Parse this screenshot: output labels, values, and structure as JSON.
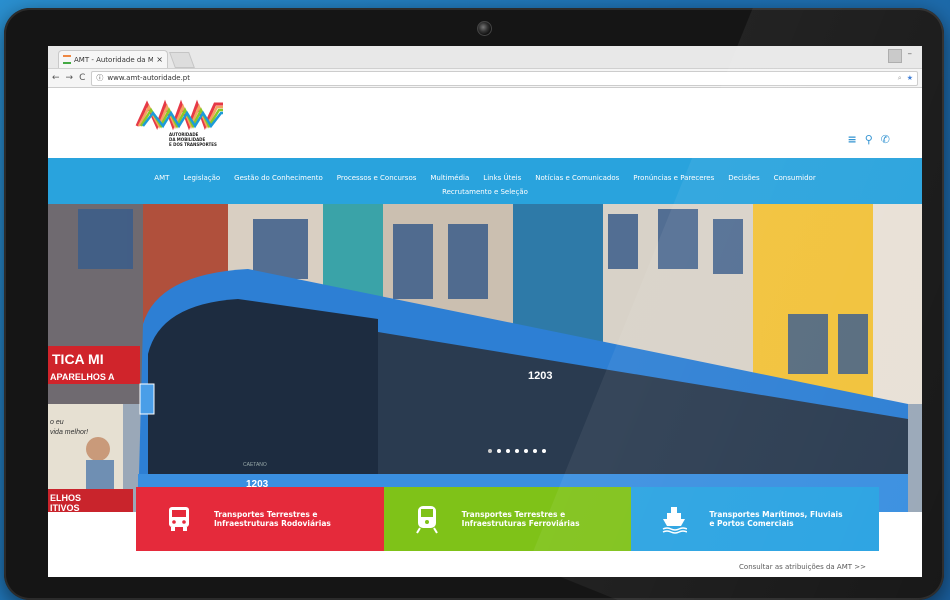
{
  "browser": {
    "tab_title": "AMT - Autoridade da M",
    "tab_close": "×",
    "url": "www.amt-autoridade.pt"
  },
  "logo": {
    "text_line1": "AUTORIDADE",
    "text_line2": "DA MOBILIDADE",
    "text_line3": "E DOS TRANSPORTES"
  },
  "nav": {
    "row1": [
      "AMT",
      "Legislação",
      "Gestão do Conhecimento",
      "Processos e Concursos",
      "Multimédia",
      "Links Úteis",
      "Notícias e Comunicados",
      "Pronúncias e Pareceres",
      "Decisões",
      "Consumidor"
    ],
    "row2": [
      "Recrutamento e Seleção"
    ]
  },
  "hero": {
    "bus_number": "1203",
    "bus_front_number": "1203",
    "bus_brand": "CAETANO",
    "shop_sign_1": "TICA MI",
    "shop_sign_2": "APARELHOS A",
    "shop_sign_3": "ELHOS",
    "shop_sign_4": "ITIVOS",
    "poster_1": "o eu",
    "poster_2": "vida melhor!"
  },
  "services": [
    {
      "line1": "Transportes Terrestres e",
      "line2": "Infraestruturas Rodoviárias",
      "icon": "bus-icon",
      "color": "#e52a3b"
    },
    {
      "line1": "Transportes Terrestres e",
      "line2": "Infraestruturas Ferroviárias",
      "icon": "train-icon",
      "color": "#7fc218"
    },
    {
      "line1": "Transportes Marítimos, Fluviais",
      "line2": "e Portos Comerciais",
      "icon": "ship-icon",
      "color": "#2aa3e2"
    }
  ],
  "consult_link": "Consultar as atribuições da AMT >>",
  "colors": {
    "nav": "#29a3dd",
    "red": "#e52a3b",
    "green": "#7fc218",
    "blue": "#2aa3e2"
  }
}
